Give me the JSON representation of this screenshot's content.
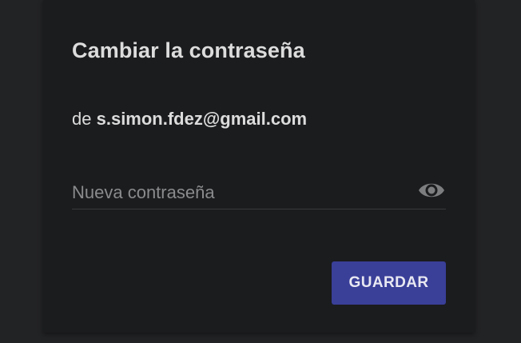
{
  "dialog": {
    "title": "Cambiar la contraseña",
    "subtitle_prefix": "de",
    "email": "s.simon.fdez@gmail.com",
    "password_field": {
      "placeholder": "Nueva contraseña",
      "value": "",
      "toggle_icon": "eye-icon"
    },
    "save_label": "GUARDAR"
  },
  "colors": {
    "page_background": "#222325",
    "card_background": "#1b1c1e",
    "text": "#dcdcdc",
    "placeholder": "#8a8b8d",
    "button": "#3a3f98"
  }
}
